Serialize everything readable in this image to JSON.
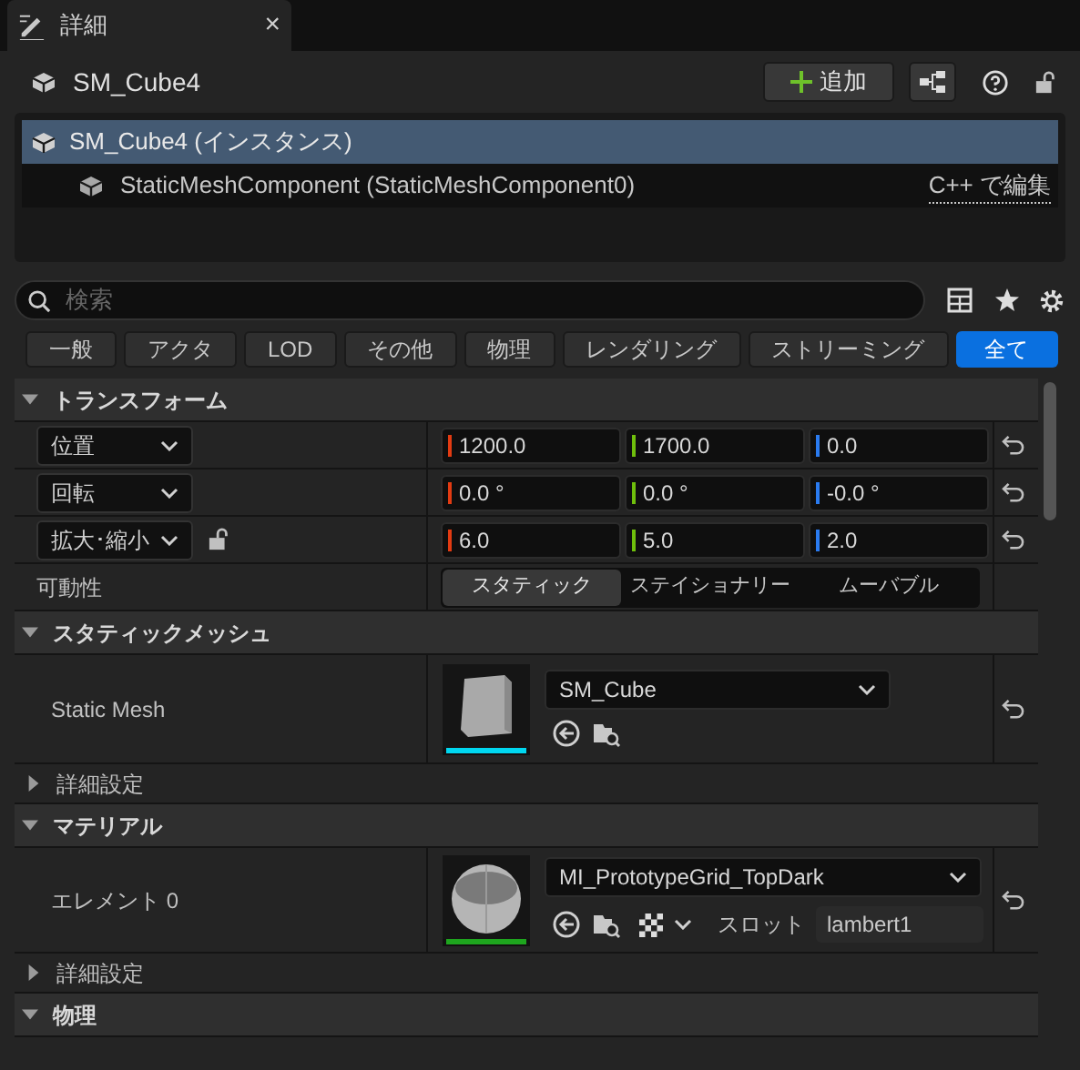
{
  "tab": {
    "title": "詳細",
    "close": "×"
  },
  "header": {
    "title": "SM_Cube4",
    "add_button": "追加"
  },
  "tree": [
    {
      "label": "SM_Cube4 (インスタンス)",
      "selected": true,
      "children": [
        {
          "label": "StaticMeshComponent (StaticMeshComponent0)",
          "selected": false,
          "link": "C++ で編集"
        }
      ]
    }
  ],
  "search": {
    "placeholder": "検索"
  },
  "filters": [
    {
      "label": "一般",
      "selected": false
    },
    {
      "label": "アクタ",
      "selected": false
    },
    {
      "label": "LOD",
      "selected": false
    },
    {
      "label": "その他",
      "selected": false
    },
    {
      "label": "物理",
      "selected": false
    },
    {
      "label": "レンダリング",
      "selected": false
    },
    {
      "label": "ストリーミング",
      "selected": false
    },
    {
      "label": "全て",
      "selected": true
    }
  ],
  "sections": [
    {
      "title": "トランスフォーム",
      "expanded": true,
      "rows": [
        {
          "kind": "vector",
          "label": "位置",
          "values": [
            "1200.0",
            "1700.0",
            "0.0"
          ]
        },
        {
          "kind": "vector",
          "label": "回転",
          "values": [
            "0.0 °",
            "0.0 °",
            "-0.0 °"
          ]
        },
        {
          "kind": "vector",
          "label": "拡大･縮小",
          "locked": false,
          "values": [
            "6.0",
            "5.0",
            "2.0"
          ]
        },
        {
          "kind": "mobility",
          "label": "可動性",
          "options": [
            {
              "label": "スタティック",
              "selected": true
            },
            {
              "label": "ステイショナリー",
              "selected": false
            },
            {
              "label": "ムーバブル",
              "selected": false
            }
          ]
        }
      ]
    },
    {
      "title": "スタティックメッシュ",
      "expanded": true,
      "rows": [
        {
          "kind": "asset",
          "label": "Static Mesh",
          "color": "#00d7f0",
          "value": "SM_Cube"
        },
        {
          "kind": "group",
          "label": "詳細設定",
          "expanded": false
        }
      ]
    },
    {
      "title": "マテリアル",
      "expanded": true,
      "rows": [
        {
          "kind": "asset",
          "label": "エレメント 0",
          "color": "#1ea51e",
          "value": "MI_PrototypeGrid_TopDark",
          "slot_label": "スロット",
          "slot": "lambert1"
        },
        {
          "kind": "group",
          "label": "詳細設定",
          "expanded": false
        }
      ]
    },
    {
      "title": "物理",
      "expanded": true
    }
  ]
}
